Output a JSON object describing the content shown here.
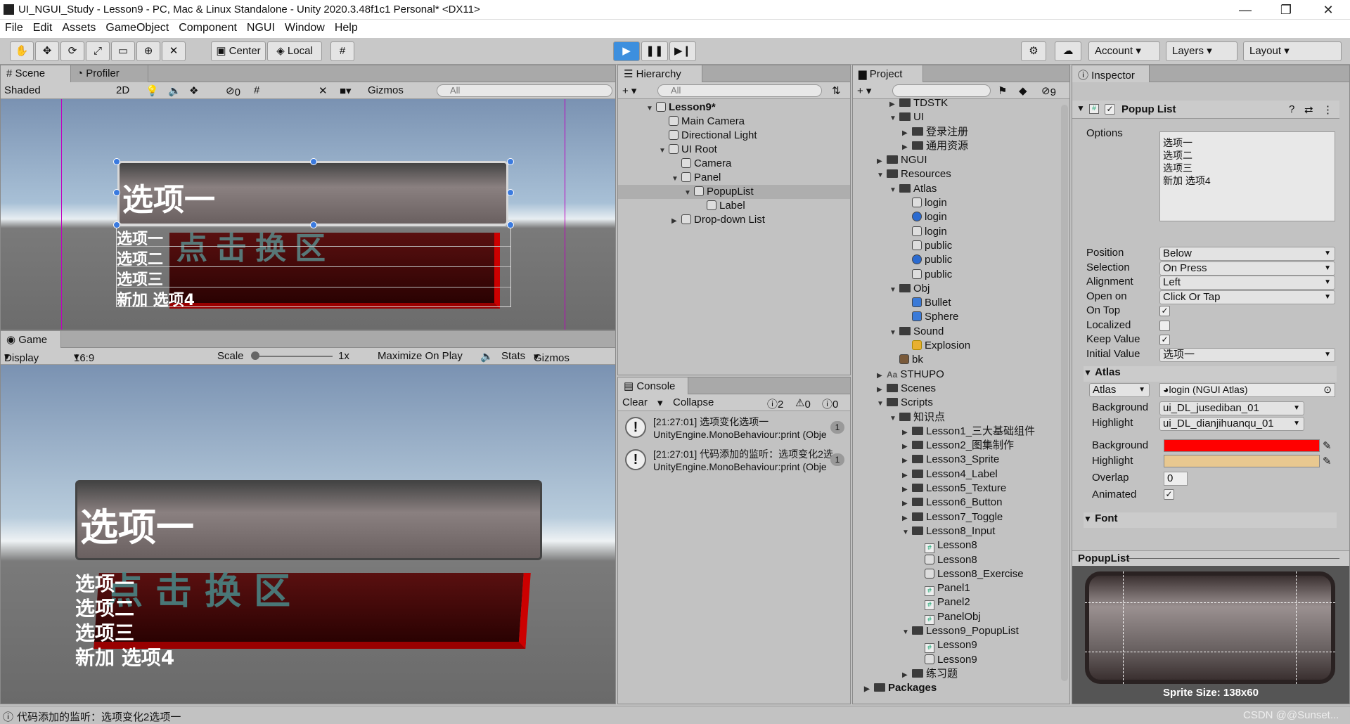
{
  "window": {
    "title": "UI_NGUI_Study - Lesson9 - PC, Mac & Linux Standalone - Unity 2020.3.48f1c1 Personal* <DX11>"
  },
  "menu": [
    "File",
    "Edit",
    "Assets",
    "GameObject",
    "Component",
    "NGUI",
    "Window",
    "Help"
  ],
  "toolbar": {
    "center": "Center",
    "local": "Local",
    "account": "Account",
    "layers": "Layers",
    "layout": "Layout"
  },
  "scene": {
    "tab_scene": "Scene",
    "tab_profiler": "Profiler",
    "shading": "Shaded",
    "mode2d": "2D",
    "hidden_count": "0",
    "gizmos": "Gizmos",
    "search": "All",
    "popup_label": "选项一",
    "options": [
      "选项一",
      "选项二",
      "选项三",
      "新加 选项4"
    ],
    "bg_text": "点击换区"
  },
  "game": {
    "tab": "Game",
    "display": "Display 1",
    "aspect": "16:9 Aspect",
    "scale_label": "Scale",
    "scale_value": "1x",
    "maximize": "Maximize On Play",
    "stats": "Stats",
    "gizmos": "Gizmos",
    "popup_label": "选项一",
    "options": [
      "选项一",
      "选项二",
      "选项三",
      "新加 选项4"
    ],
    "bg_text": "点击换区"
  },
  "hierarchy": {
    "tab": "Hierarchy",
    "search": "All",
    "items": [
      {
        "label": "Lesson9*",
        "indent": 0,
        "arrow": "▼",
        "icon": "scene"
      },
      {
        "label": "Main Camera",
        "indent": 1,
        "arrow": "",
        "icon": "go"
      },
      {
        "label": "Directional Light",
        "indent": 1,
        "arrow": "",
        "icon": "go"
      },
      {
        "label": "UI Root",
        "indent": 1,
        "arrow": "▼",
        "icon": "go"
      },
      {
        "label": "Camera",
        "indent": 2,
        "arrow": "",
        "icon": "go"
      },
      {
        "label": "Panel",
        "indent": 2,
        "arrow": "▼",
        "icon": "go"
      },
      {
        "label": "PopupList",
        "indent": 3,
        "arrow": "▼",
        "icon": "go",
        "selected": true
      },
      {
        "label": "Label",
        "indent": 4,
        "arrow": "",
        "icon": "go"
      },
      {
        "label": "Drop-down List",
        "indent": 2,
        "arrow": "▶",
        "icon": "go"
      }
    ]
  },
  "console": {
    "tab": "Console",
    "clear": "Clear",
    "collapse": "Collapse",
    "info_count": "2",
    "warn_count": "0",
    "err_count": "0",
    "entries": [
      {
        "line1": "[21:27:01] 选项变化选项一",
        "line2": "UnityEngine.MonoBehaviour:print (Obje",
        "count": "1"
      },
      {
        "line1": "[21:27:01] 代码添加的监听：选项变化2选",
        "line2": "UnityEngine.MonoBehaviour:print (Obje",
        "count": "1"
      }
    ]
  },
  "project": {
    "tab": "Project",
    "hidden_count": "9",
    "items": [
      {
        "label": "TDSTK",
        "indent": 2,
        "arrow": "▶",
        "icon": "folder"
      },
      {
        "label": "UI",
        "indent": 2,
        "arrow": "▼",
        "icon": "folder"
      },
      {
        "label": "登录注册",
        "indent": 3,
        "arrow": "▶",
        "icon": "folder"
      },
      {
        "label": "通用资源",
        "indent": 3,
        "arrow": "▶",
        "icon": "folder"
      },
      {
        "label": "NGUI",
        "indent": 1,
        "arrow": "▶",
        "icon": "folder"
      },
      {
        "label": "Resources",
        "indent": 1,
        "arrow": "▼",
        "icon": "folder"
      },
      {
        "label": "Atlas",
        "indent": 2,
        "arrow": "▼",
        "icon": "folder"
      },
      {
        "label": "login",
        "indent": 3,
        "arrow": "",
        "icon": "atlas"
      },
      {
        "label": "login",
        "indent": 3,
        "arrow": "",
        "icon": "material"
      },
      {
        "label": "login",
        "indent": 3,
        "arrow": "",
        "icon": "texture"
      },
      {
        "label": "public",
        "indent": 3,
        "arrow": "",
        "icon": "atlas"
      },
      {
        "label": "public",
        "indent": 3,
        "arrow": "",
        "icon": "material"
      },
      {
        "label": "public",
        "indent": 3,
        "arrow": "",
        "icon": "texture"
      },
      {
        "label": "Obj",
        "indent": 2,
        "arrow": "▼",
        "icon": "folder"
      },
      {
        "label": "Bullet",
        "indent": 3,
        "arrow": "",
        "icon": "prefab"
      },
      {
        "label": "Sphere",
        "indent": 3,
        "arrow": "",
        "icon": "prefab"
      },
      {
        "label": "Sound",
        "indent": 2,
        "arrow": "▼",
        "icon": "folder"
      },
      {
        "label": "Explosion",
        "indent": 3,
        "arrow": "",
        "icon": "audio"
      },
      {
        "label": "bk",
        "indent": 2,
        "arrow": "",
        "icon": "image"
      },
      {
        "label": "STHUPO",
        "indent": 1,
        "arrow": "▶",
        "icon": "font"
      },
      {
        "label": "Scenes",
        "indent": 1,
        "arrow": "▶",
        "icon": "folder"
      },
      {
        "label": "Scripts",
        "indent": 1,
        "arrow": "▼",
        "icon": "folder"
      },
      {
        "label": "知识点",
        "indent": 2,
        "arrow": "▼",
        "icon": "folder"
      },
      {
        "label": "Lesson1_三大基础组件",
        "indent": 3,
        "arrow": "▶",
        "icon": "folder"
      },
      {
        "label": "Lesson2_图集制作",
        "indent": 3,
        "arrow": "▶",
        "icon": "folder"
      },
      {
        "label": "Lesson3_Sprite",
        "indent": 3,
        "arrow": "▶",
        "icon": "folder"
      },
      {
        "label": "Lesson4_Label",
        "indent": 3,
        "arrow": "▶",
        "icon": "folder"
      },
      {
        "label": "Lesson5_Texture",
        "indent": 3,
        "arrow": "▶",
        "icon": "folder"
      },
      {
        "label": "Lesson6_Button",
        "indent": 3,
        "arrow": "▶",
        "icon": "folder"
      },
      {
        "label": "Lesson7_Toggle",
        "indent": 3,
        "arrow": "▶",
        "icon": "folder"
      },
      {
        "label": "Lesson8_Input",
        "indent": 3,
        "arrow": "▼",
        "icon": "folder"
      },
      {
        "label": "Lesson8",
        "indent": 4,
        "arrow": "",
        "icon": "script"
      },
      {
        "label": "Lesson8",
        "indent": 4,
        "arrow": "",
        "icon": "scene"
      },
      {
        "label": "Lesson8_Exercise",
        "indent": 4,
        "arrow": "",
        "icon": "scene"
      },
      {
        "label": "Panel1",
        "indent": 4,
        "arrow": "",
        "icon": "script"
      },
      {
        "label": "Panel2",
        "indent": 4,
        "arrow": "",
        "icon": "script"
      },
      {
        "label": "PanelObj",
        "indent": 4,
        "arrow": "",
        "icon": "script"
      },
      {
        "label": "Lesson9_PopupList",
        "indent": 3,
        "arrow": "▼",
        "icon": "folder"
      },
      {
        "label": "Lesson9",
        "indent": 4,
        "arrow": "",
        "icon": "script"
      },
      {
        "label": "Lesson9",
        "indent": 4,
        "arrow": "",
        "icon": "scene"
      },
      {
        "label": "练习题",
        "indent": 3,
        "arrow": "▶",
        "icon": "folder"
      },
      {
        "label": "Packages",
        "indent": 0,
        "arrow": "▶",
        "icon": "folder",
        "bold": true
      }
    ]
  },
  "inspector": {
    "tab": "Inspector",
    "component": "Popup List",
    "options_label": "Options",
    "options": [
      "选项一",
      "选项二",
      "选项三",
      "新加 选项4"
    ],
    "fields": [
      {
        "label": "Position",
        "value": "Below",
        "type": "dropdown"
      },
      {
        "label": "Selection",
        "value": "On Press",
        "type": "dropdown"
      },
      {
        "label": "Alignment",
        "value": "Left",
        "type": "dropdown"
      },
      {
        "label": "Open on",
        "value": "Click Or Tap",
        "type": "dropdown"
      },
      {
        "label": "On Top",
        "value": "✓",
        "type": "check"
      },
      {
        "label": "Localized",
        "value": "",
        "type": "check"
      },
      {
        "label": "Keep Value",
        "value": "✓",
        "type": "check"
      },
      {
        "label": "Initial Value",
        "value": "选项一",
        "type": "dropdown"
      }
    ],
    "atlas_section": "Atlas",
    "atlas_dd": "Atlas",
    "atlas_value": "login (NGUI Atlas)",
    "background_label": "Background",
    "background_value": "ui_DL_jusediban_01",
    "highlight_label": "Highlight",
    "highlight_value": "ui_DL_dianjihuanqu_01",
    "bg_color_label": "Background",
    "bg_color": "#ff0000",
    "hl_color_label": "Highlight",
    "hl_color": "#e8c890",
    "overlap_label": "Overlap",
    "overlap_value": "0",
    "animated_label": "Animated",
    "animated_value": "✓",
    "font_section": "Font",
    "preview_title": "PopupList",
    "sprite_size": "Sprite Size: 138x60"
  },
  "status": {
    "text": "代码添加的监听：选项变化2选项一",
    "watermark": "CSDN @@Sunset..."
  }
}
